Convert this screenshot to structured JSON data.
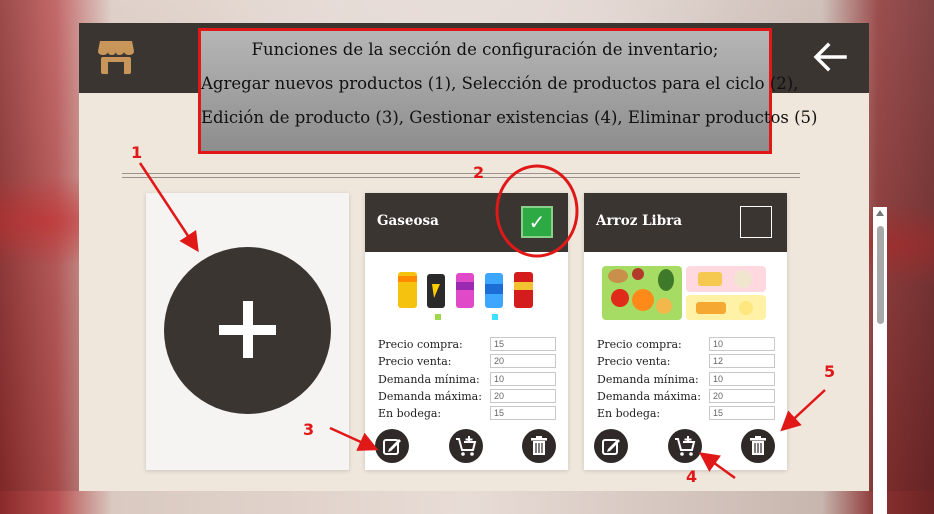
{
  "annotation": {
    "lines": [
      "Funciones de la sección de configuración de inventario;",
      "Agregar nuevos productos (1), Selección de productos para el ciclo (2),",
      "Edición de producto (3), Gestionar existencias (4), Eliminar productos (5)"
    ],
    "markers": [
      "1",
      "2",
      "3",
      "4",
      "5"
    ],
    "color": "#e01818"
  },
  "header": {
    "store_icon": "store-icon",
    "back_icon": "back-arrow-icon",
    "bar_color": "#3b3532"
  },
  "add_card": {
    "icon": "plus-icon"
  },
  "field_labels": [
    "Precio compra:",
    "Precio venta:",
    "Demanda mínima:",
    "Demanda máxima:",
    "En bodega:"
  ],
  "products": [
    {
      "name": "Gaseosa",
      "selected": true,
      "image": "soda-cans-image",
      "values": [
        "15",
        "20",
        "10",
        "20",
        "15"
      ],
      "actions": [
        "edit-icon",
        "add-to-cart-icon",
        "trash-icon"
      ]
    },
    {
      "name": "Arroz Libra",
      "selected": false,
      "image": "food-items-image",
      "values": [
        "10",
        "12",
        "10",
        "20",
        "15"
      ],
      "actions": [
        "edit-icon",
        "add-to-cart-icon",
        "trash-icon"
      ]
    }
  ],
  "colors": {
    "accent_green": "#2eaa44",
    "panel": "#efe6dc",
    "dark": "#3b3532"
  }
}
